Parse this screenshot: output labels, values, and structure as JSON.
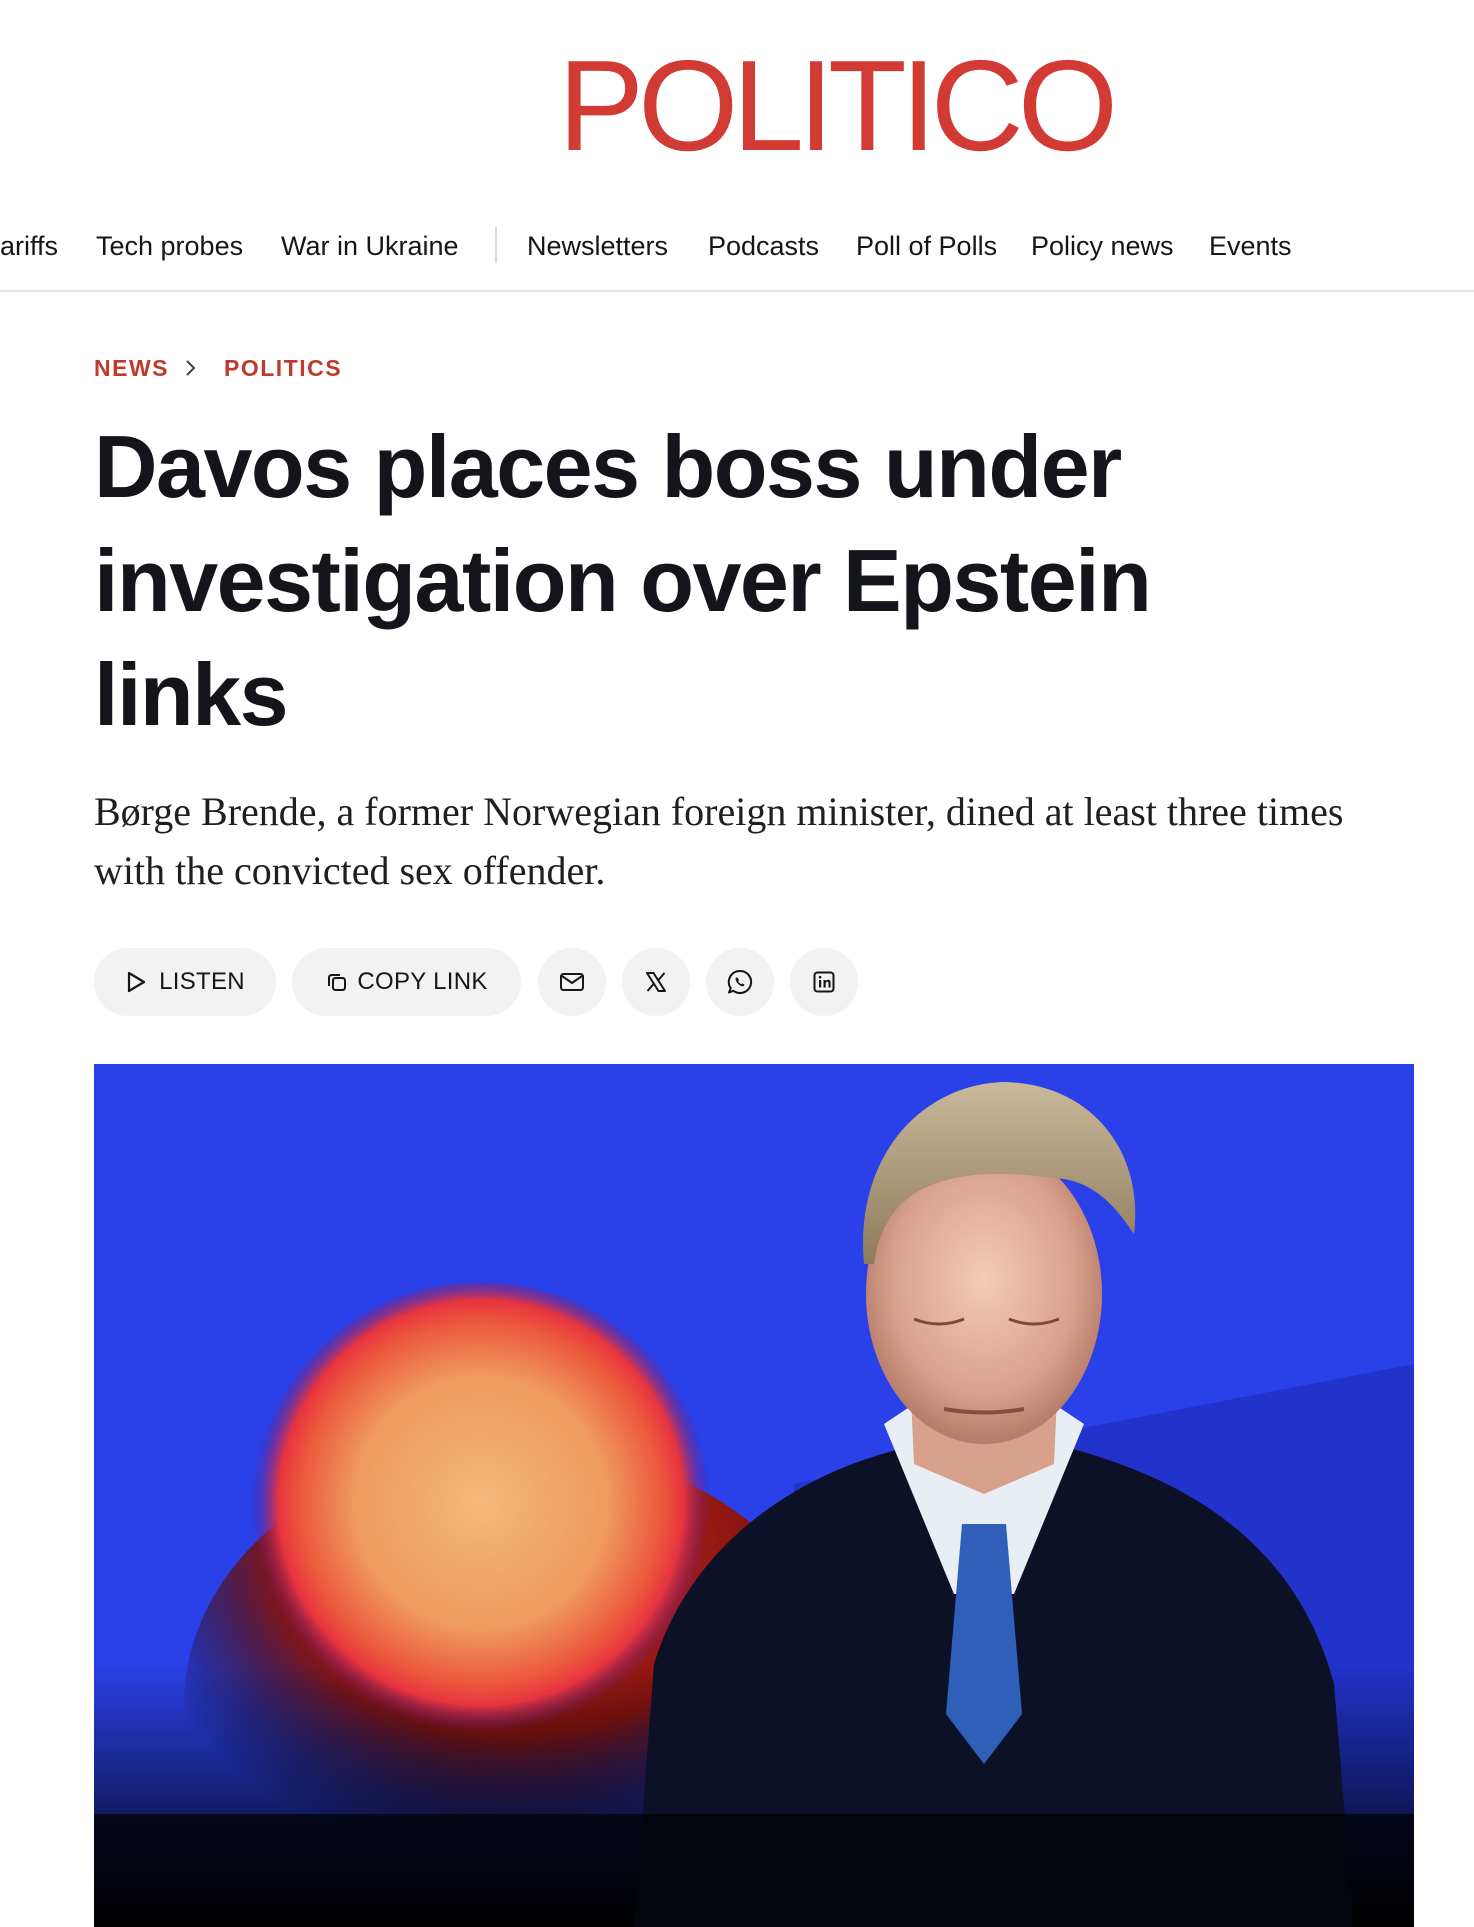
{
  "site": {
    "logo": "POLITICO",
    "brand_color": "#d23b33"
  },
  "nav": {
    "items": [
      {
        "label": "ariffs"
      },
      {
        "label": "Tech probes"
      },
      {
        "label": "War in Ukraine"
      },
      {
        "label": "Newsletters"
      },
      {
        "label": "Podcasts"
      },
      {
        "label": "Poll of Polls"
      },
      {
        "label": "Policy news"
      },
      {
        "label": "Events"
      }
    ]
  },
  "breadcrumb": {
    "items": [
      {
        "label": "NEWS"
      },
      {
        "label": "POLITICS"
      }
    ],
    "separator_icon": "chevron-right-icon"
  },
  "article": {
    "title": "Davos places boss under investigation over Epstein links",
    "subtitle": "Børge Brende, a former Norwegian foreign minister, dined at least three times with the convicted sex offender."
  },
  "share": {
    "listen_label": "LISTEN",
    "copy_link_label": "COPY LINK",
    "icons": [
      "play-icon",
      "copy-icon",
      "email-icon",
      "x-icon",
      "whatsapp-icon",
      "linkedin-icon"
    ]
  },
  "hero": {
    "image_icon": "article-photo"
  }
}
